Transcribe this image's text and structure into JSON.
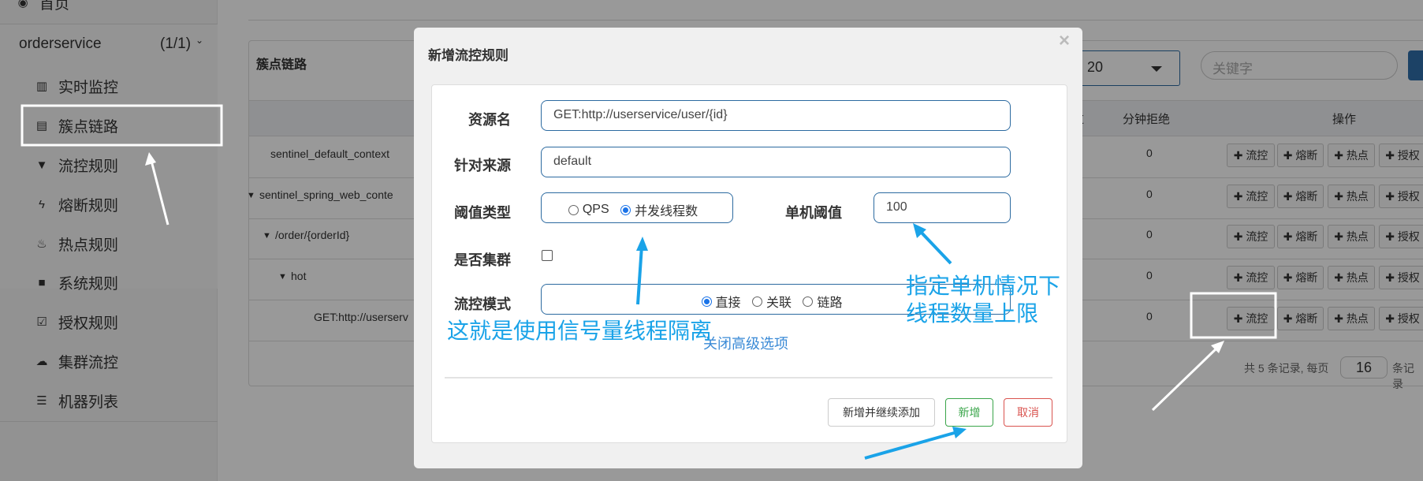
{
  "sidebar": {
    "home": "首页",
    "app_name": "orderservice",
    "app_count": "(1/1)",
    "items": [
      {
        "label": "实时监控",
        "icon": "bar-chart-icon"
      },
      {
        "label": "簇点链路",
        "icon": "list-icon"
      },
      {
        "label": "流控规则",
        "icon": "filter-icon"
      },
      {
        "label": "熔断规则",
        "icon": "bolt-icon"
      },
      {
        "label": "热点规则",
        "icon": "fire-icon"
      },
      {
        "label": "系统规则",
        "icon": "lock-icon"
      },
      {
        "label": "授权规则",
        "icon": "check-square-icon"
      },
      {
        "label": "集群流控",
        "icon": "cloud-icon"
      },
      {
        "label": "机器列表",
        "icon": "th-list-icon"
      }
    ]
  },
  "main": {
    "card_title": "簇点链路",
    "select_value": "20",
    "keyword_placeholder": "关键字",
    "headers": {
      "pass": "通过",
      "block": "分钟拒绝",
      "ops": "操作"
    },
    "rows": [
      {
        "resource": "sentinel_default_context",
        "block": "0"
      },
      {
        "resource": "sentinel_spring_web_conte",
        "block": "0"
      },
      {
        "resource": "/order/{orderId}",
        "block": "0"
      },
      {
        "resource": "hot",
        "block": "0"
      },
      {
        "resource": "GET:http://userserv",
        "block": "0"
      }
    ],
    "op_buttons": [
      "流控",
      "熔断",
      "热点",
      "授权"
    ],
    "pager": {
      "prefix": "共 5 条记录, 每页",
      "page_size": "16",
      "suffix": "条记录"
    }
  },
  "modal": {
    "title": "新增流控规则",
    "close": "×",
    "resource_label": "资源名",
    "resource_value": "GET:http://userservice/user/{id}",
    "origin_label": "针对来源",
    "origin_value": "default",
    "grade_label": "阈值类型",
    "grade_qps": "QPS",
    "grade_thread": "并发线程数",
    "threshold_label": "单机阈值",
    "threshold_value": "100",
    "cluster_label": "是否集群",
    "mode_label": "流控模式",
    "mode_direct": "直接",
    "mode_relate": "关联",
    "mode_chain": "链路",
    "advanced_link": "关闭高级选项",
    "btn_add_continue": "新增并继续添加",
    "btn_add": "新增",
    "btn_cancel": "取消"
  },
  "annotations": {
    "semaphore_note": "这就是使用信号量线程隔离",
    "threshold_note_1": "指定单机情况下",
    "threshold_note_2": "线程数量上限",
    "color": "#1aa3e8"
  }
}
